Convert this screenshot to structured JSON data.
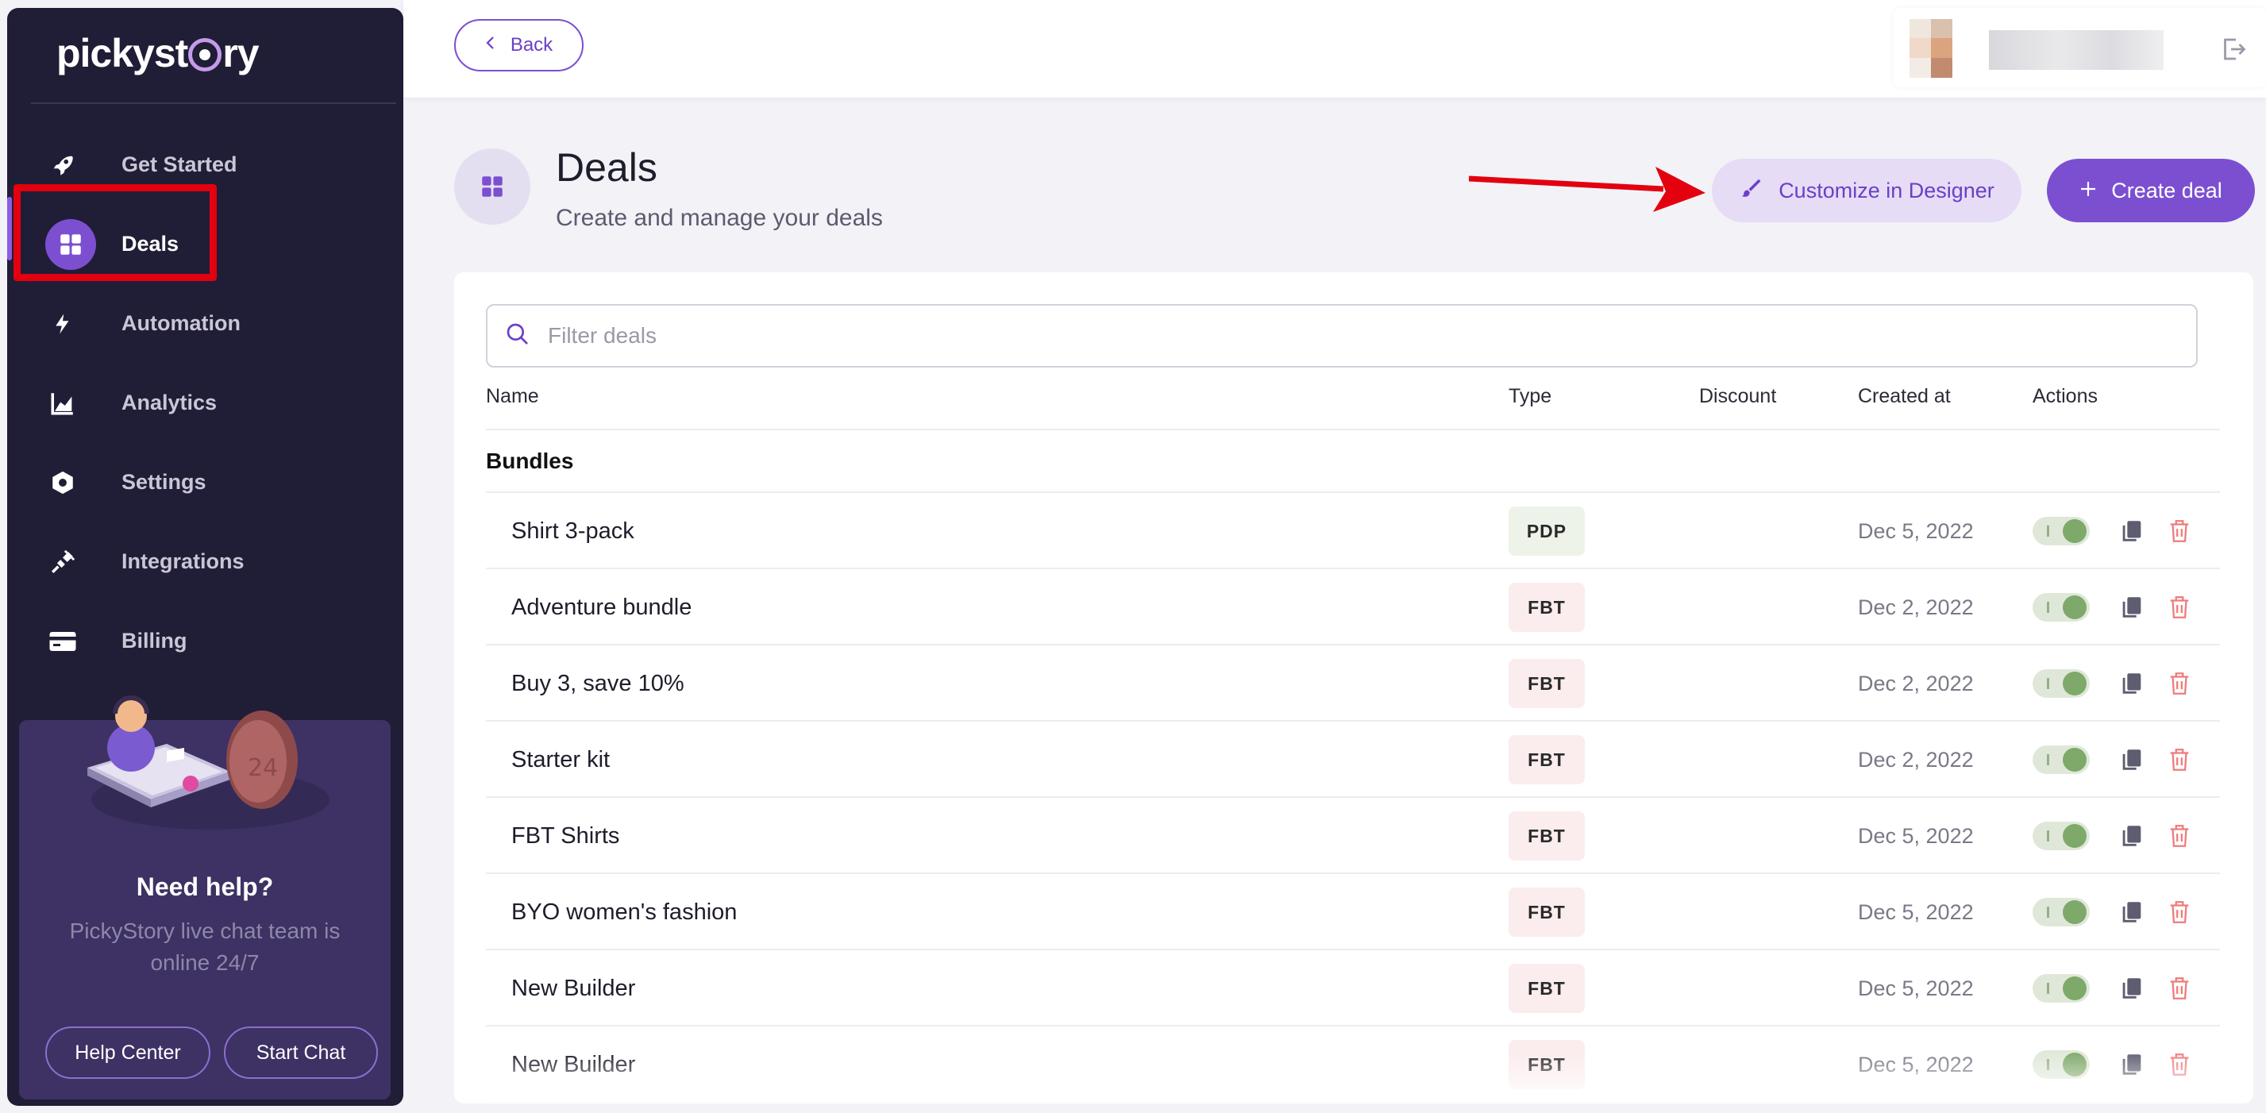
{
  "sidebar": {
    "logo_text_before": "pickyst",
    "logo_text_after": "ry",
    "items": [
      {
        "label": "Get Started",
        "icon": "rocket-icon"
      },
      {
        "label": "Deals",
        "icon": "grid-icon",
        "active": true
      },
      {
        "label": "Automation",
        "icon": "lightning-icon"
      },
      {
        "label": "Analytics",
        "icon": "chart-icon"
      },
      {
        "label": "Settings",
        "icon": "hexagon-icon"
      },
      {
        "label": "Integrations",
        "icon": "plug-icon"
      },
      {
        "label": "Billing",
        "icon": "card-icon"
      }
    ],
    "help": {
      "title": "Need help?",
      "text": "PickyStory live chat team is online 24/7",
      "help_center": "Help Center",
      "start_chat": "Start Chat"
    }
  },
  "topbar": {
    "back_label": "Back"
  },
  "header": {
    "title": "Deals",
    "subtitle": "Create and manage your deals",
    "customize_label": "Customize in Designer",
    "create_label": "Create deal"
  },
  "table": {
    "search_placeholder": "Filter deals",
    "columns": {
      "name": "Name",
      "type": "Type",
      "discount": "Discount",
      "created": "Created at",
      "actions": "Actions"
    },
    "group": "Bundles",
    "rows": [
      {
        "name": "Shirt 3-pack",
        "type": "PDP",
        "discount": "",
        "created": "Dec 5, 2022",
        "enabled": true
      },
      {
        "name": "Adventure bundle",
        "type": "FBT",
        "discount": "",
        "created": "Dec 2, 2022",
        "enabled": true
      },
      {
        "name": "Buy 3, save 10%",
        "type": "FBT",
        "discount": "",
        "created": "Dec 2, 2022",
        "enabled": true
      },
      {
        "name": "Starter kit",
        "type": "FBT",
        "discount": "",
        "created": "Dec 2, 2022",
        "enabled": true
      },
      {
        "name": "FBT Shirts",
        "type": "FBT",
        "discount": "",
        "created": "Dec 5, 2022",
        "enabled": true
      },
      {
        "name": "BYO women's fashion",
        "type": "FBT",
        "discount": "",
        "created": "Dec 5, 2022",
        "enabled": true
      },
      {
        "name": "New Builder",
        "type": "FBT",
        "discount": "",
        "created": "Dec 5, 2022",
        "enabled": true
      },
      {
        "name": "New Builder",
        "type": "FBT",
        "discount": "",
        "created": "Dec 5, 2022",
        "enabled": true
      }
    ]
  },
  "colors": {
    "accent": "#7c4fd1",
    "sidebar_bg": "#201d36",
    "annotation_red": "#e3000f",
    "toggle_on": "#7ea96a"
  }
}
